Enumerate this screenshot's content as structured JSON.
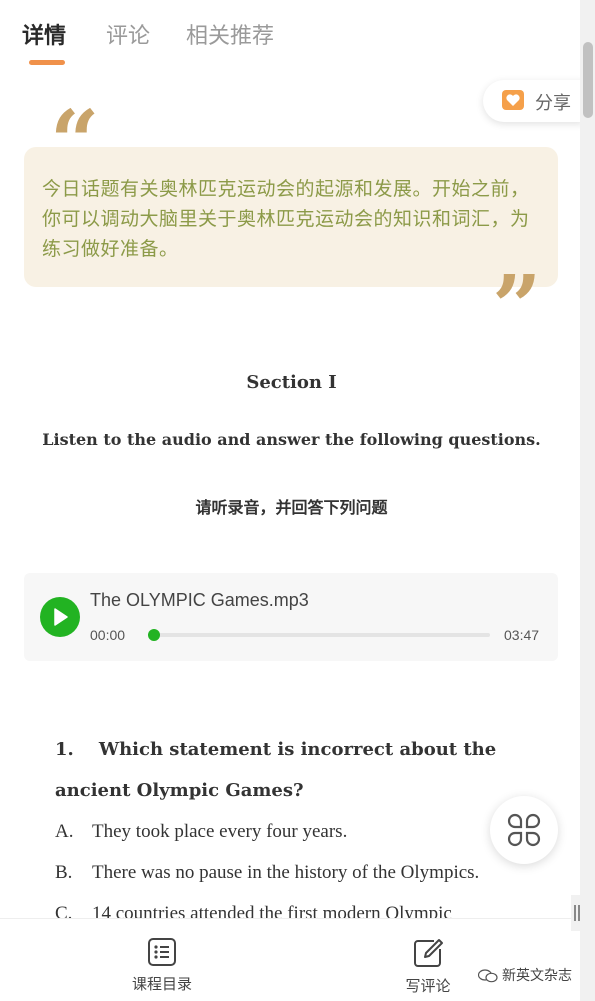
{
  "tabs": [
    {
      "label": "详情",
      "active": true
    },
    {
      "label": "评论",
      "active": false
    },
    {
      "label": "相关推荐",
      "active": false
    }
  ],
  "share": {
    "label": "分享",
    "icon": "heart-share-icon"
  },
  "quote": {
    "open_mark": "“",
    "close_mark": "”",
    "text": "今日话题有关奥林匹克运动会的起源和发展。开始之前，你可以调动大脑里关于奥林匹克运动会的知识和词汇，为练习做好准备。"
  },
  "section": {
    "title": "Section I",
    "instruction_en": "Listen to the audio and answer the following questions.",
    "instruction_cn": "请听录音，并回答下列问题"
  },
  "audio": {
    "title": "The OLYMPIC Games.mp3",
    "current_time": "00:00",
    "duration": "03:47",
    "progress_fraction": 0.0,
    "accent": "#22b322"
  },
  "question": {
    "line1": "1.    Which statement is incorrect about the",
    "line2": "ancient Olympic Games?",
    "options": [
      {
        "letter": "A.",
        "text": "They took place every four years."
      },
      {
        "letter": "B.",
        "text": "There was no pause in the history of the Olympics."
      },
      {
        "letter": "C.",
        "text": "14 countries attended the first modern Olympic"
      }
    ]
  },
  "bottom_bar": {
    "catalog_label": "课程目录",
    "comment_label": "写评论"
  },
  "watermark": "新英文杂志",
  "colors": {
    "tab_underline": "#f0914a",
    "quote_bg": "#f8f1e4",
    "quote_text": "#8c9a48",
    "quote_marks": "#c9a46a"
  }
}
